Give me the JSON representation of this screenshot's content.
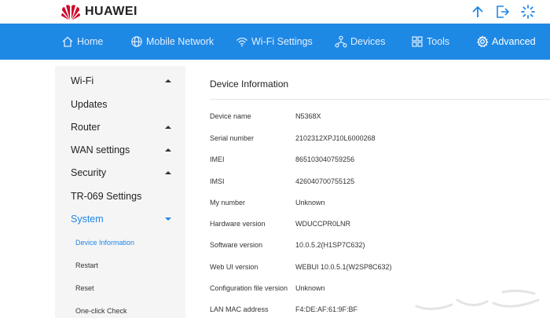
{
  "brand": {
    "name": "HUAWEI",
    "color": "#cf0a2c"
  },
  "top_icons": [
    "upload-arrow-icon",
    "logout-icon",
    "loading-spinner-icon"
  ],
  "nav": {
    "color": "#1e88e5",
    "items": [
      {
        "label": "Home",
        "icon": "home-icon"
      },
      {
        "label": "Mobile Network",
        "icon": "globe-icon"
      },
      {
        "label": "Wi-Fi Settings",
        "icon": "wifi-icon"
      },
      {
        "label": "Devices",
        "icon": "devices-icon"
      },
      {
        "label": "Tools",
        "icon": "tools-icon"
      },
      {
        "label": "Advanced",
        "icon": "gear-icon",
        "active": true
      }
    ]
  },
  "sidebar": {
    "items": [
      {
        "label": "Wi-Fi",
        "expandable": true
      },
      {
        "label": "Updates",
        "expandable": false
      },
      {
        "label": "Router",
        "expandable": true
      },
      {
        "label": "WAN settings",
        "expandable": true
      },
      {
        "label": "Security",
        "expandable": true
      },
      {
        "label": "TR-069 Settings",
        "expandable": false
      },
      {
        "label": "System",
        "expandable": true,
        "open": true
      }
    ],
    "sub_items": [
      {
        "label": "Device Information",
        "active": true
      },
      {
        "label": "Restart"
      },
      {
        "label": "Reset"
      },
      {
        "label": "One-click Check"
      }
    ]
  },
  "content": {
    "title": "Device Information",
    "rows": [
      {
        "label": "Device name",
        "value": "N5368X"
      },
      {
        "label": "Serial number",
        "value": "2102312XPJ10L6000268"
      },
      {
        "label": "IMEI",
        "value": "865103040759256"
      },
      {
        "label": "IMSI",
        "value": "426040700755125"
      },
      {
        "label": "My number",
        "value": "Unknown"
      },
      {
        "label": "Hardware version",
        "value": "WDUCCPR0LNR"
      },
      {
        "label": "Software version",
        "value": "10.0.5.2(H1SP7C632)"
      },
      {
        "label": "Web UI version",
        "value": "WEBUI 10.0.5.1(W2SP8C632)"
      },
      {
        "label": "Configuration file version",
        "value": "Unknown"
      },
      {
        "label": "LAN MAC address",
        "value": "F4:DE:AF:61:9F:BF"
      }
    ]
  }
}
